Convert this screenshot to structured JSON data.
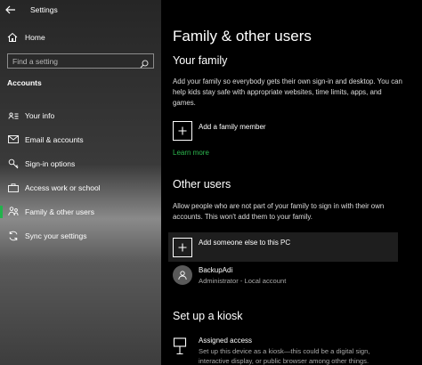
{
  "window": {
    "title": "Settings"
  },
  "sidebar": {
    "home_label": "Home",
    "search_placeholder": "Find a setting",
    "section": "Accounts",
    "items": [
      {
        "label": "Your info",
        "icon": "contact-card-icon"
      },
      {
        "label": "Email & accounts",
        "icon": "mail-icon"
      },
      {
        "label": "Sign-in options",
        "icon": "key-icon"
      },
      {
        "label": "Access work or school",
        "icon": "briefcase-icon"
      },
      {
        "label": "Family & other users",
        "icon": "family-icon",
        "active": true
      },
      {
        "label": "Sync your settings",
        "icon": "sync-icon"
      }
    ],
    "accent_color": "#22b24c"
  },
  "main": {
    "title": "Family & other users",
    "your_family": {
      "heading": "Your family",
      "description": "Add your family so everybody gets their own sign-in and desktop. You can help kids stay safe with appropriate websites, time limits, apps, and games.",
      "add_label": "Add a family member",
      "learn_more": "Learn more"
    },
    "other_users": {
      "heading": "Other users",
      "description": "Allow people who are not part of your family to sign in with their own accounts. This won't add them to your family.",
      "add_label": "Add someone else to this PC",
      "user": {
        "name": "BackupAdi",
        "detail": "Administrator - Local account"
      }
    },
    "kiosk": {
      "heading": "Set up a kiosk",
      "item_label": "Assigned access",
      "item_desc_line1": "Set up this device as a kiosk—this could be a digital sign,",
      "item_desc_line2": "interactive display, or public browser among other things."
    }
  }
}
